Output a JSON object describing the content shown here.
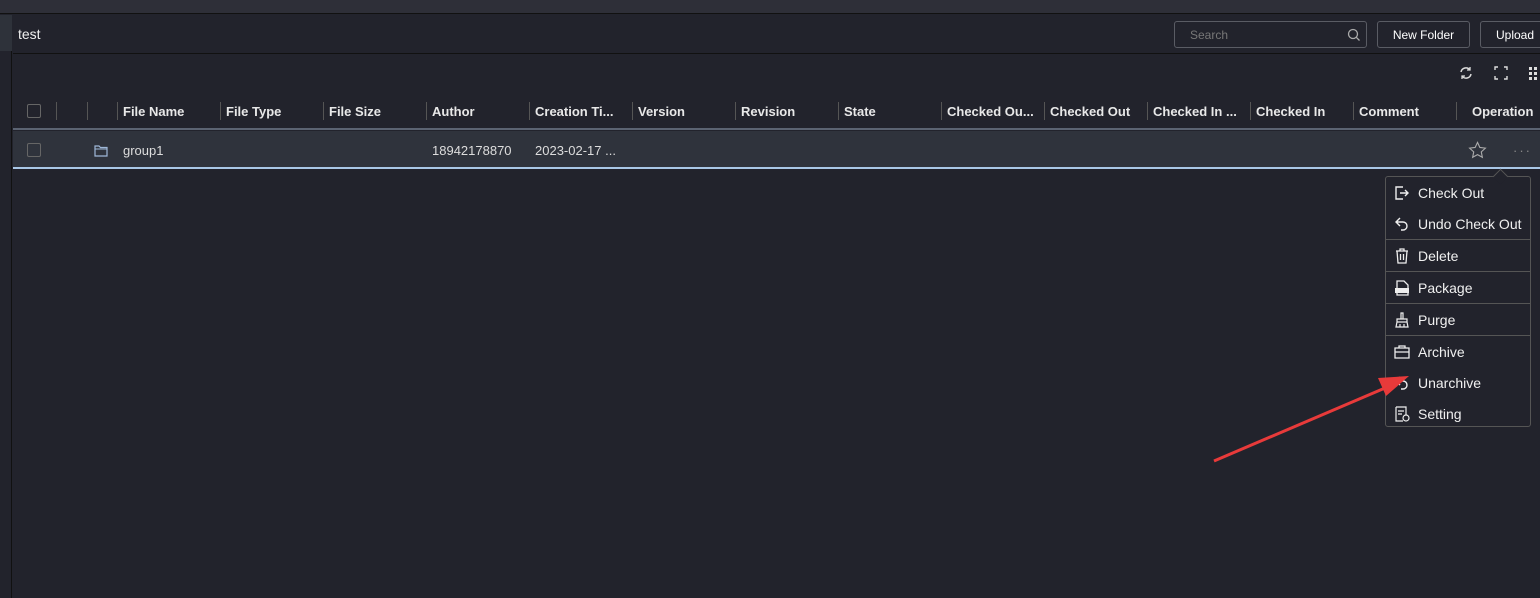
{
  "header": {
    "title": "test",
    "search_placeholder": "Search",
    "new_folder": "New Folder",
    "upload": "Upload"
  },
  "toolbar": {
    "icons": [
      "refresh-icon",
      "fullscreen-icon",
      "columns-icon"
    ]
  },
  "table": {
    "columns": [
      "File Name",
      "File Type",
      "File Size",
      "Author",
      "Creation Ti...",
      "Version",
      "Revision",
      "State",
      "Checked Ou...",
      "Checked Out",
      "Checked In ...",
      "Checked In",
      "Comment",
      "Operation"
    ],
    "rows": [
      {
        "file_name": "group1",
        "file_type": "",
        "file_size": "",
        "author": "18942178870",
        "creation_time": "2023-02-17 ...",
        "icon": "folder-icon"
      }
    ]
  },
  "menu": {
    "items": [
      {
        "label": "Check Out",
        "icon": "check-out-icon"
      },
      {
        "label": "Undo Check Out",
        "icon": "undo-icon"
      },
      {
        "label": "Delete",
        "icon": "trash-icon"
      },
      {
        "label": "Package",
        "icon": "zip-file-icon"
      },
      {
        "label": "Purge",
        "icon": "broom-icon"
      },
      {
        "label": "Archive",
        "icon": "archive-box-icon"
      },
      {
        "label": "Unarchive",
        "icon": "unarchive-icon"
      },
      {
        "label": "Setting",
        "icon": "setting-doc-icon"
      }
    ]
  },
  "annotation": {
    "arrow_color": "#e83a3a"
  }
}
